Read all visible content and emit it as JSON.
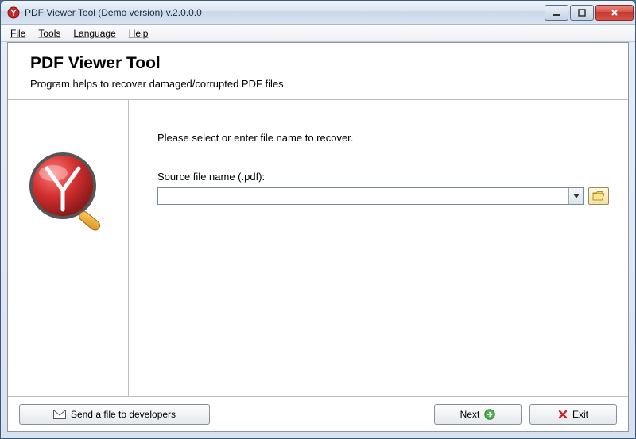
{
  "window": {
    "title": "PDF Viewer Tool (Demo version) v.2.0.0.0"
  },
  "menu": {
    "file": "File",
    "tools": "Tools",
    "language": "Language",
    "help": "Help"
  },
  "header": {
    "title": "PDF Viewer Tool",
    "subtitle": "Program helps to recover damaged/corrupted PDF files."
  },
  "main": {
    "instruction": "Please select or enter file name to recover.",
    "field_label": "Source file name (.pdf):",
    "file_value": ""
  },
  "footer": {
    "send_label": "Send a file to developers",
    "next_label": "Next",
    "exit_label": "Exit"
  }
}
